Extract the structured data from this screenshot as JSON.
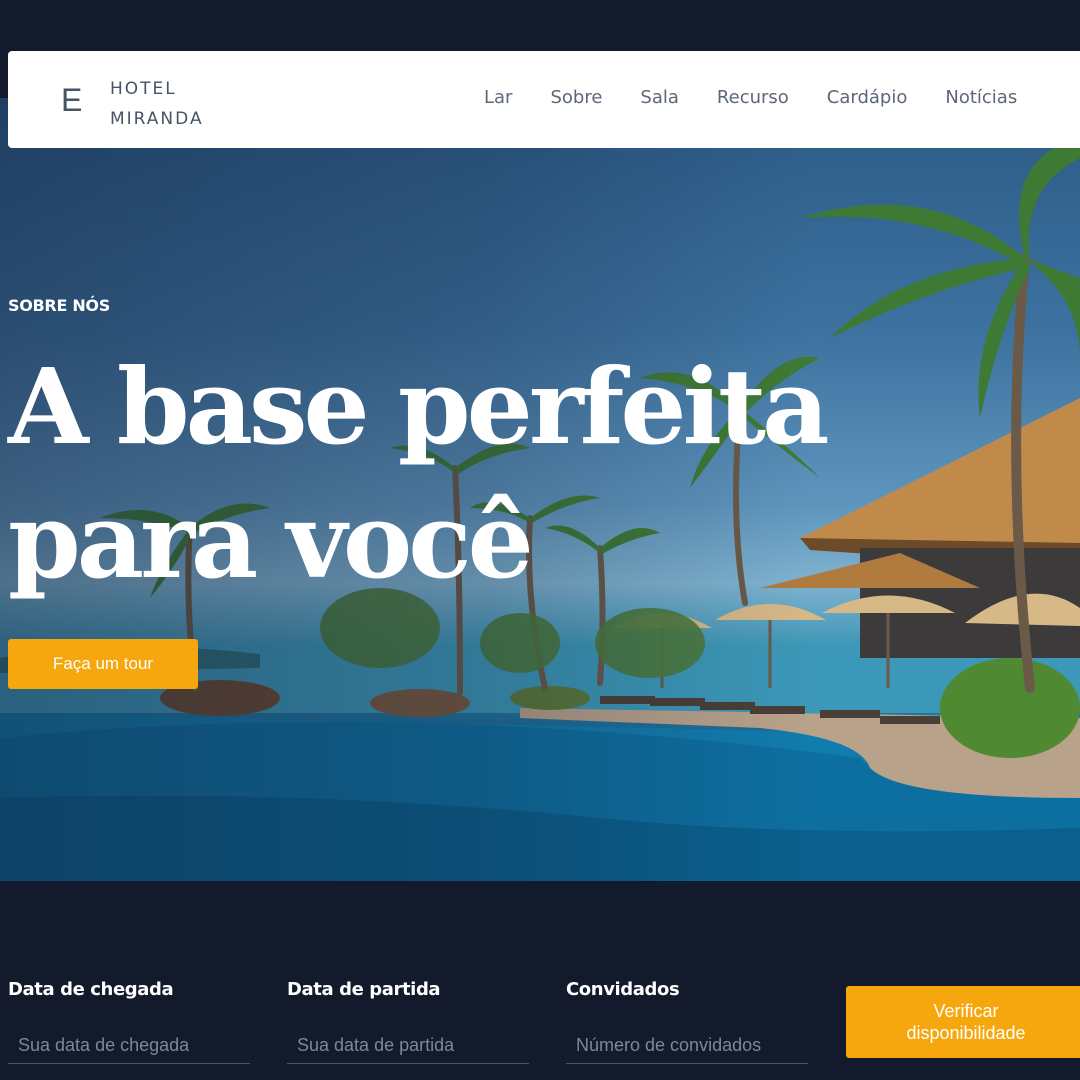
{
  "brand": {
    "mark": "E",
    "line1": "HOTEL",
    "line2": "MIRANDA"
  },
  "nav": {
    "items": [
      "Lar",
      "Sobre",
      "Sala",
      "Recurso",
      "Cardápio",
      "Notícias"
    ]
  },
  "hero": {
    "eyebrow": "SOBRE NÓS",
    "headline_line1": "A base perfeita",
    "headline_line2": "para você",
    "cta_label": "Faça um tour",
    "background": "tropical-resort-pool-photo"
  },
  "booking": {
    "arrival": {
      "label": "Data de chegada",
      "placeholder": "Sua data de chegada"
    },
    "departure": {
      "label": "Data de partida",
      "placeholder": "Sua data de partida"
    },
    "guests": {
      "label": "Convidados",
      "placeholder": "Número de convidados"
    },
    "submit_label": "Verificar disponibilidade"
  },
  "colors": {
    "background": "#121a2b",
    "accent": "#f5a70d",
    "nav_text": "#5d6778",
    "brand_text": "#475366"
  }
}
